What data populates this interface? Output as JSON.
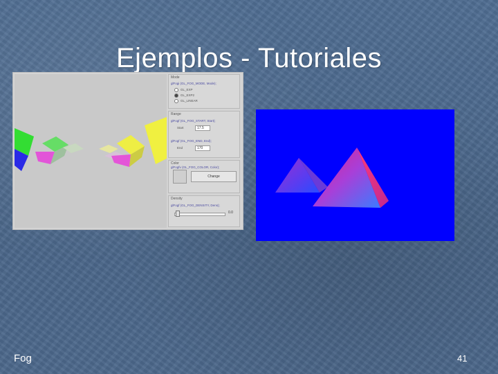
{
  "slide": {
    "title": "Ejemplos - Tutoriales",
    "footer_text": "Fog",
    "page_number": "41"
  },
  "fog_app": {
    "mode": {
      "title": "Mode",
      "code": "glFogi (GL_FOG_MODE, Mode);",
      "options": [
        "GL_EXP",
        "GL_EXP2",
        "GL_LINEAR"
      ],
      "selected_index": 1
    },
    "range": {
      "title": "Range",
      "start_code": "glFogf (GL_FOG_START, Start);",
      "start_label": "Start",
      "start_value": "17.5",
      "end_code": "glFogf (GL_FOG_END, End);",
      "end_label": "End",
      "end_value": "170"
    },
    "color": {
      "title": "Color",
      "code": "glFogfv (GL_FOG_COLOR, Color);",
      "button_label": "Change"
    },
    "density": {
      "title": "Density",
      "code": "glFogf (GL_FOG_DENSITY, Dens);",
      "value": "0.0"
    }
  },
  "colors": {
    "slide_background": "#4d6a8e",
    "pyramid_background": "#0000ff"
  }
}
